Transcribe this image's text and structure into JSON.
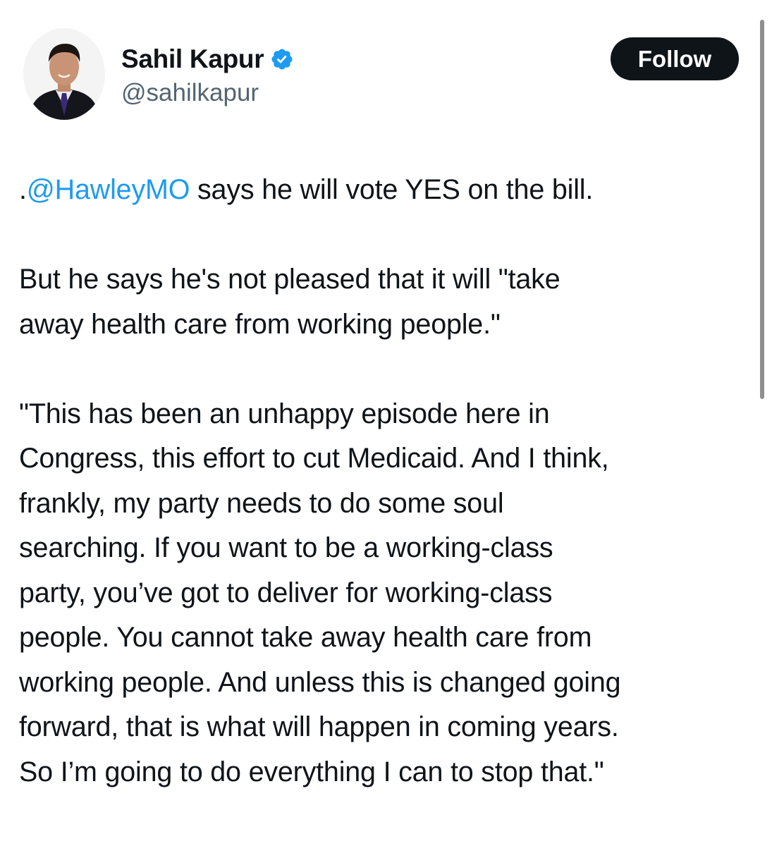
{
  "author": {
    "display_name": "Sahil Kapur",
    "handle": "@sahilkapur",
    "verified": true,
    "avatar_icon": "profile-photo-avatar"
  },
  "follow_button": {
    "label": "Follow"
  },
  "tweet": {
    "line1": {
      "prefix": ".",
      "mention": "@HawleyMO",
      "rest": " says he will vote YES on the bill."
    },
    "paragraph2": [
      "But he says he's not pleased that it will \"take",
      "away health care from working people.\""
    ],
    "paragraph3": [
      "\"This has been an unhappy episode here in",
      "Congress, this effort to cut Medicaid. And I think,",
      "frankly, my party needs to do some soul",
      "searching. If you want to be a working-class",
      "party, you’ve got to deliver for working-class",
      "people. You cannot take away health care from",
      "working people. And unless this is changed going",
      "forward, that is what will happen in coming years.",
      "So I’m going to do everything I can to stop that.\""
    ]
  },
  "colors": {
    "text": "#0f1419",
    "secondary_text": "#536471",
    "link": "#1d9bf0",
    "verified_badge": "#1d9bf0",
    "follow_button_bg": "#0f1419",
    "follow_button_text": "#ffffff"
  }
}
